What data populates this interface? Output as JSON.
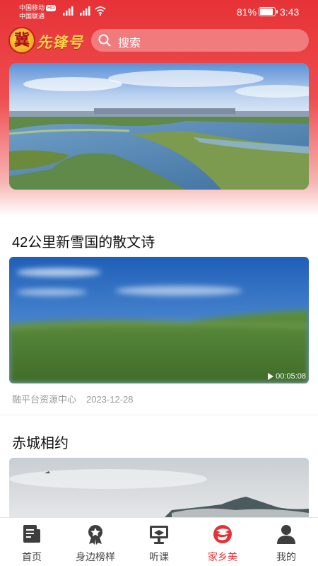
{
  "status_bar": {
    "carrier1": "中国移动",
    "hd_badge": "HD",
    "carrier2": "中国联通",
    "battery": "81%",
    "time": "3:43"
  },
  "header": {
    "logo_seal_char": "冀",
    "logo_text": "先锋号",
    "search_placeholder": "搜索"
  },
  "articles": [
    {
      "title": "42公里新雪国的散文诗",
      "duration": "00:05:08",
      "source": "融平台资源中心",
      "date": "2023-12-28"
    },
    {
      "title": "赤城相约"
    }
  ],
  "tabs": [
    {
      "label": "首页",
      "icon": "news-icon",
      "active": false
    },
    {
      "label": "身边榜样",
      "icon": "medal-icon",
      "active": false
    },
    {
      "label": "听课",
      "icon": "lecture-icon",
      "active": false
    },
    {
      "label": "家乡美",
      "icon": "hometown-icon",
      "active": true
    },
    {
      "label": "我的",
      "icon": "profile-icon",
      "active": false
    }
  ],
  "colors": {
    "brand_red": "#e63236",
    "logo_gold": "#ffd34a"
  }
}
